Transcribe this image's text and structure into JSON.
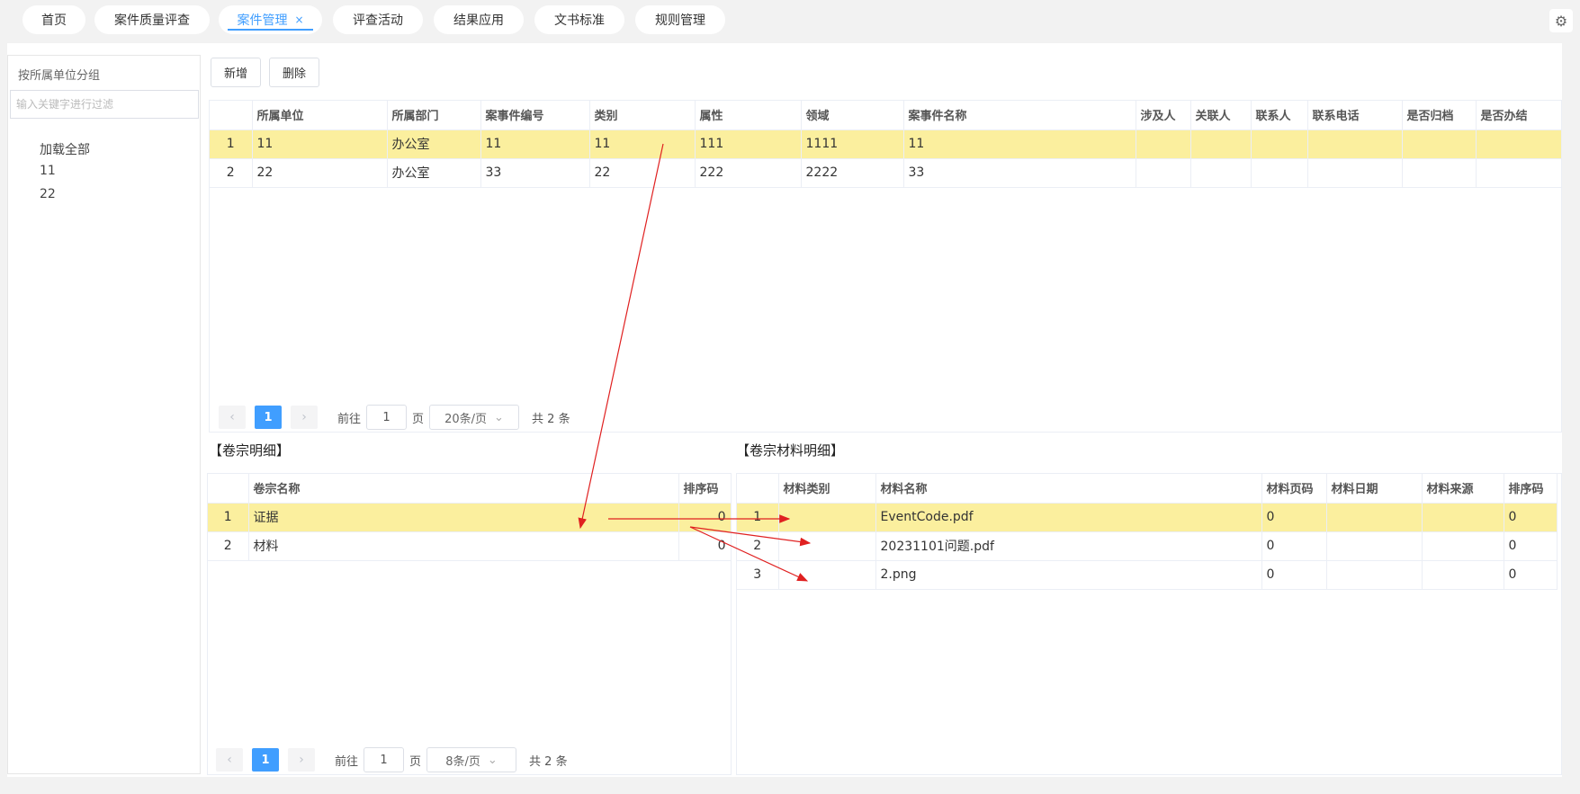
{
  "tabs": [
    {
      "label": "首页"
    },
    {
      "label": "案件质量评查"
    },
    {
      "label": "案件管理"
    },
    {
      "label": "评查活动"
    },
    {
      "label": "结果应用"
    },
    {
      "label": "文书标准"
    },
    {
      "label": "规则管理"
    }
  ],
  "tab_close_glyph": "×",
  "settings_glyph": "⚙",
  "sidebar": {
    "title": "按所属单位分组",
    "filter_placeholder": "输入关键字进行过滤",
    "items": [
      "加载全部",
      "11",
      "22"
    ]
  },
  "toolbar": {
    "add_label": "新增",
    "delete_label": "删除"
  },
  "case_table": {
    "headers": [
      "",
      "所属单位",
      "所属部门",
      "案事件编号",
      "类别",
      "属性",
      "领域",
      "案事件名称",
      "涉及人",
      "关联人",
      "联系人",
      "联系电话",
      "是否归档",
      "是否办结"
    ],
    "rows": [
      [
        "1",
        "11",
        "办公室",
        "11",
        "11",
        "111",
        "1111",
        "11",
        "",
        "",
        "",
        "",
        "",
        ""
      ],
      [
        "2",
        "22",
        "办公室",
        "33",
        "22",
        "222",
        "2222",
        "33",
        "",
        "",
        "",
        "",
        "",
        ""
      ]
    ]
  },
  "case_pager": {
    "prev": "‹",
    "page": "1",
    "next": "›",
    "goto_label": "前往",
    "goto_value": "1",
    "page_unit": "页",
    "page_size": "20条/页",
    "dropdown": "⌄",
    "total": "共 2 条"
  },
  "volume": {
    "title": "【卷宗明细】",
    "headers": [
      "",
      "卷宗名称",
      "排序码"
    ],
    "rows": [
      [
        "1",
        "证据",
        "0"
      ],
      [
        "2",
        "材料",
        "0"
      ]
    ],
    "pager": {
      "prev": "‹",
      "page": "1",
      "next": "›",
      "goto_label": "前往",
      "goto_value": "1",
      "page_unit": "页",
      "page_size": "8条/页",
      "dropdown": "⌄",
      "total": "共 2 条"
    }
  },
  "material": {
    "title": "【卷宗材料明细】",
    "headers": [
      "",
      "材料类别",
      "材料名称",
      "材料页码",
      "材料日期",
      "材料来源",
      "排序码"
    ],
    "rows": [
      [
        "1",
        "",
        "EventCode.pdf",
        "0",
        "",
        "",
        "0"
      ],
      [
        "2",
        "",
        "20231101问题.pdf",
        "0",
        "",
        "",
        "0"
      ],
      [
        "3",
        "",
        "2.png",
        "0",
        "",
        "",
        "0"
      ]
    ]
  },
  "colors": {
    "accent": "#409eff",
    "selected_row": "#fbef9e",
    "arrow": "#e02020"
  }
}
